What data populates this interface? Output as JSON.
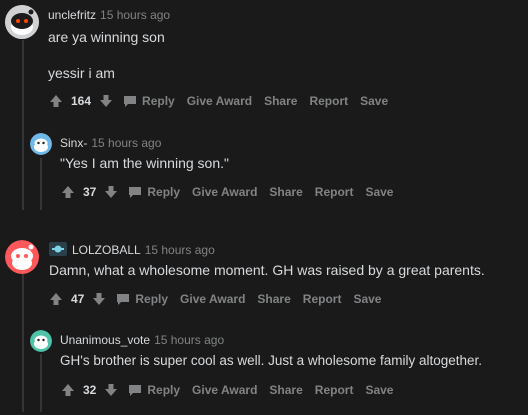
{
  "colors": {
    "background": "#1a1a1b",
    "text": "#d7dadc",
    "muted": "#818384",
    "thread_line": "#343536"
  },
  "actions": {
    "reply": "Reply",
    "give_award": "Give Award",
    "share": "Share",
    "report": "Report",
    "save": "Save"
  },
  "comments": [
    {
      "author": "unclefritz",
      "time": "15 hours ago",
      "lines": [
        "are ya winning son",
        "yessir i am"
      ],
      "score": "164",
      "avatar_icon": "snoo-avatar-gray-icon"
    },
    {
      "author": "Sinx-",
      "time": "15 hours ago",
      "lines": [
        "\"Yes I am the winning son.\""
      ],
      "score": "37",
      "avatar_icon": "snoo-avatar-blue-icon"
    },
    {
      "author": "LOLZOBALL",
      "time": "15 hours ago",
      "lines": [
        "Damn, what a wholesome moment. GH was raised by a great parents."
      ],
      "score": "47",
      "avatar_icon": "snoo-avatar-red-icon",
      "flair_icon": "user-flair-icon"
    },
    {
      "author": "Unanimous_vote",
      "time": "15 hours ago",
      "lines": [
        "GH's brother is super cool as well. Just a wholesome family altogether."
      ],
      "score": "32",
      "avatar_icon": "snoo-avatar-teal-icon"
    }
  ]
}
